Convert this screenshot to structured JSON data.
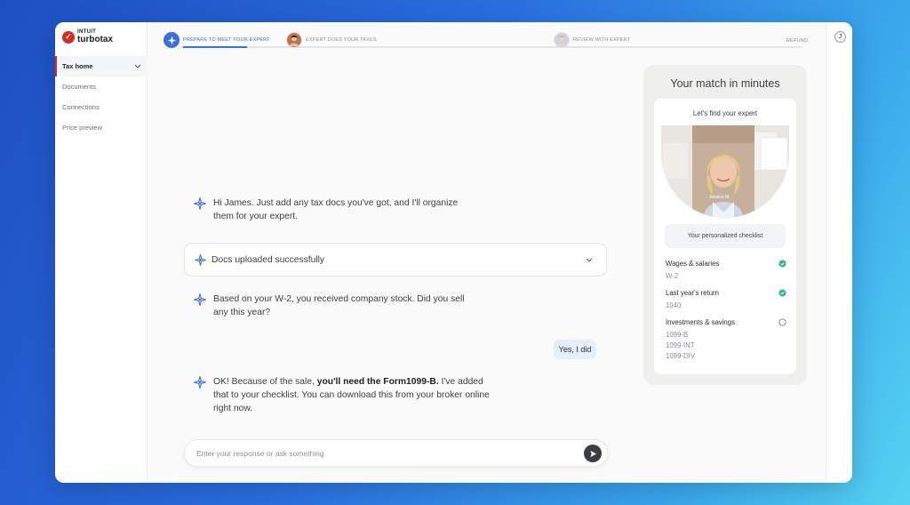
{
  "app": {
    "brand_top": "INTUIT",
    "brand_name": "turbotax"
  },
  "sidebar": {
    "items": [
      {
        "label": "Tax home",
        "active": true
      },
      {
        "label": "Documents",
        "active": false
      },
      {
        "label": "Connections",
        "active": false
      },
      {
        "label": "Price preview",
        "active": false
      }
    ]
  },
  "user": {
    "initial": "J"
  },
  "steps": {
    "items": [
      {
        "label": "PREPARE TO MEET YOUR EXPERT",
        "state": "current"
      },
      {
        "label": "EXPERT DOES YOUR TAXES",
        "state": "upcoming"
      },
      {
        "label": "REVIEW WITH EXPERT",
        "state": "upcoming"
      }
    ],
    "end_label": "REFUND",
    "current_progress": 0.45
  },
  "chat": {
    "messages": [
      {
        "from": "assistant",
        "text": "Hi James. Just add any tax docs you've got, and I'll organize them for your expert."
      },
      {
        "from": "assistant",
        "text": "Based on your W-2, you received company stock. Did you sell any this year?"
      },
      {
        "from": "user",
        "text": "Yes, I did"
      },
      {
        "from": "assistant",
        "text_before": "OK! Because of the sale, ",
        "text_bold": "you'll need the Form1099-B.",
        "text_after": " I've added that to your checklist. You can download this from your broker online right now."
      }
    ],
    "uploaded_label": "Docs uploaded successfully",
    "input_placeholder": "Enter your response or ask something"
  },
  "match": {
    "title": "Your match in minutes",
    "subtitle": "Let's find your expert",
    "expert_name": "Jessica M.",
    "checklist_label": "Your personalized checklist",
    "items": [
      {
        "title": "Wages & salaries",
        "docs": [
          "W-2"
        ],
        "done": true
      },
      {
        "title": "Last year's return",
        "docs": [
          "1040"
        ],
        "done": true
      },
      {
        "title": "Investments & savings",
        "docs": [
          "1099-B",
          "1099-INT",
          "1099-DIV"
        ],
        "done": false
      }
    ]
  },
  "colors": {
    "brand_red": "#d52b1e",
    "accent_blue": "#3d6fd8",
    "check_green": "#3db08f"
  }
}
